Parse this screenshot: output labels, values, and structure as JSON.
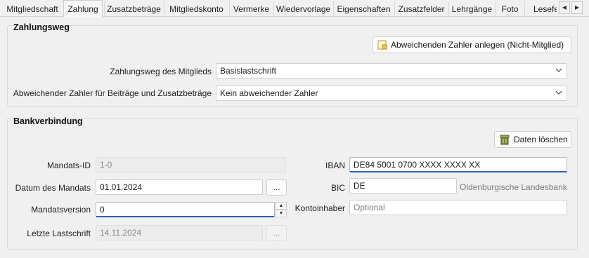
{
  "tabs": [
    {
      "label": "Mitgliedschaft",
      "active": false
    },
    {
      "label": "Zahlung",
      "active": true
    },
    {
      "label": "Zusatzbeträge",
      "active": false
    },
    {
      "label": "Mitgliedskonto",
      "active": false
    },
    {
      "label": "Vermerke",
      "active": false
    },
    {
      "label": "Wiedervorlage",
      "active": false
    },
    {
      "label": "Eigenschaften",
      "active": false
    },
    {
      "label": "Zusatzfelder",
      "active": false
    },
    {
      "label": "Lehrgänge",
      "active": false
    },
    {
      "label": "Foto",
      "active": false
    },
    {
      "label": "Lesefe",
      "active": false
    }
  ],
  "zahlungsweg": {
    "title": "Zahlungsweg",
    "payer_button_label": "Abweichenden Zahler anlegen (Nicht-Mitglied)",
    "method_label": "Zahlungsweg des Mitglieds",
    "method_value": "Basislastschrift",
    "payer_label": "Abweichender Zahler für Beiträge und Zusatzbeträge",
    "payer_value": "Kein abweichender Zahler"
  },
  "bank": {
    "title": "Bankverbindung",
    "delete_button_label": "Daten löschen",
    "mandate_id_label": "Mandats-ID",
    "mandate_id_value": "1-0",
    "mandate_date_label": "Datum des Mandats",
    "mandate_date_value": "01.01.2024",
    "date_picker_label": "...",
    "mandate_version_label": "Mandatsversion",
    "mandate_version_value": "0",
    "last_debit_label": "Letzte Lastschrift",
    "last_debit_value": "14.11.2024",
    "last_debit_picker_label": "...",
    "iban_label": "IBAN",
    "iban_value": "DE84 5001 0700 XXXX XXXX XX",
    "bic_label": "BIC",
    "bic_value": "DE",
    "bank_name": "Oldenburgische Landesbank",
    "holder_label": "Kontoinhaber",
    "holder_placeholder": "Optional"
  },
  "colors": {
    "focus_underline": "#2f5fb3",
    "disabled_text": "#8a8a8a"
  }
}
